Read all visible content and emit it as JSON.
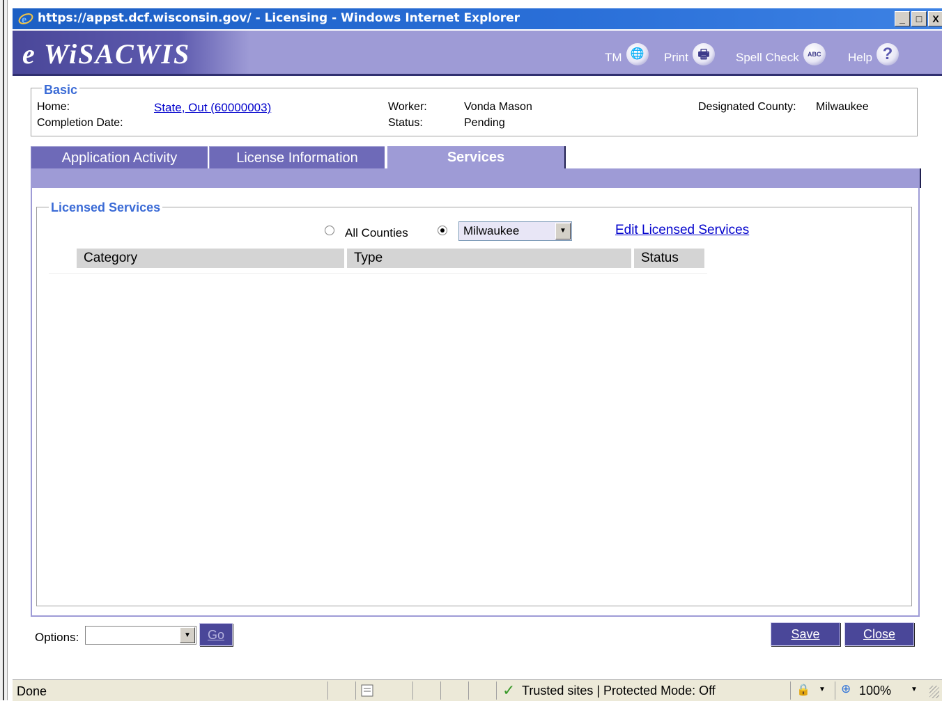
{
  "window": {
    "title": "https://appst.dcf.wisconsin.gov/ - Licensing - Windows Internet Explorer",
    "buttons": [
      "_",
      "□",
      "X"
    ]
  },
  "header": {
    "logo": "e WiSACWIS",
    "tools": [
      {
        "label": "TM",
        "icon": "globe-icon",
        "glyph": "🌐"
      },
      {
        "label": "Print",
        "icon": "printer-icon",
        "glyph": "🖶"
      },
      {
        "label": "Spell Check",
        "icon": "spellcheck-icon",
        "glyph": "ABC"
      },
      {
        "label": "Help",
        "icon": "help-icon",
        "glyph": "?"
      }
    ]
  },
  "basic": {
    "legend": "Basic",
    "home_label": "Home:",
    "home_value": "State, Out (60000003)",
    "completion_label": "Completion Date:",
    "worker_label": "Worker:",
    "worker_value": "Vonda Mason",
    "status_label": "Status:",
    "status_value": "Pending",
    "county_label": "Designated County:",
    "county_value": "Milwaukee"
  },
  "tabs": [
    {
      "label": "Application Activity",
      "active": false
    },
    {
      "label": "License Information",
      "active": false
    },
    {
      "label": "Services",
      "active": true
    }
  ],
  "licensed_services": {
    "legend": "Licensed Services",
    "radio_all_label": "All Counties",
    "radio_all_checked": false,
    "radio_county_checked": true,
    "county_select_value": "Milwaukee",
    "edit_link": "Edit Licensed Services",
    "columns": [
      "Category",
      "Type",
      "Status"
    ],
    "rows": []
  },
  "footer": {
    "options_label": "Options:",
    "options_value": "",
    "go_label": "Go",
    "save_label": "Save",
    "close_label": "Close"
  },
  "statusbar": {
    "left_text": "Done",
    "zone_text": "Trusted sites | Protected Mode: Off",
    "zoom_text": "100%"
  }
}
